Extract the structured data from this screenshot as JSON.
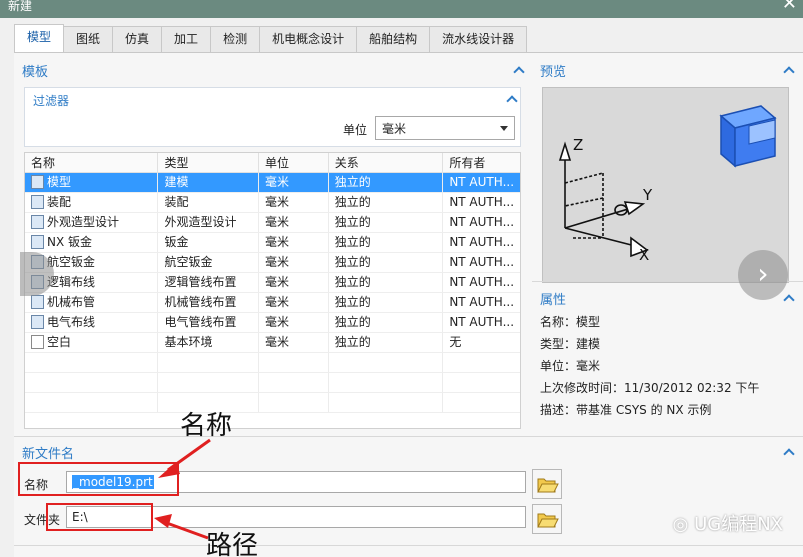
{
  "window": {
    "title": "新建"
  },
  "tabs": [
    "模型",
    "图纸",
    "仿真",
    "加工",
    "检测",
    "机电概念设计",
    "船舶结构",
    "流水线设计器"
  ],
  "template_section": {
    "title": "模板"
  },
  "filter": {
    "title": "过滤器",
    "unit_label": "单位",
    "unit_value": "毫米"
  },
  "table": {
    "headers": [
      "名称",
      "类型",
      "单位",
      "关系",
      "所有者"
    ],
    "rows": [
      [
        "模型",
        "建模",
        "毫米",
        "独立的",
        "NT AUTH..."
      ],
      [
        "装配",
        "装配",
        "毫米",
        "独立的",
        "NT AUTH..."
      ],
      [
        "外观造型设计",
        "外观造型设计",
        "毫米",
        "独立的",
        "NT AUTH..."
      ],
      [
        "NX 钣金",
        "钣金",
        "毫米",
        "独立的",
        "NT AUTH..."
      ],
      [
        "航空钣金",
        "航空钣金",
        "毫米",
        "独立的",
        "NT AUTH..."
      ],
      [
        "逻辑布线",
        "逻辑管线布置",
        "毫米",
        "独立的",
        "NT AUTH..."
      ],
      [
        "机械布管",
        "机械管线布置",
        "毫米",
        "独立的",
        "NT AUTH..."
      ],
      [
        "电气布线",
        "电气管线布置",
        "毫米",
        "独立的",
        "NT AUTH..."
      ],
      [
        "空白",
        "基本环境",
        "毫米",
        "独立的",
        "无"
      ]
    ],
    "selected_index": 0
  },
  "preview": {
    "title": "预览",
    "axis_x": "X",
    "axis_y": "Y",
    "axis_z": "Z"
  },
  "properties": {
    "title": "属性",
    "name_label": "名称：",
    "name_value": "模型",
    "type_label": "类型：",
    "type_value": "建模",
    "unit_label": "单位：",
    "unit_value": "毫米",
    "modified_label": "上次修改时间：",
    "modified_value": "11/30/2012 02:32 下午",
    "desc_label": "描述：",
    "desc_value": "带基准 CSYS 的 NX 示例"
  },
  "new_file": {
    "title": "新文件名",
    "name_label": "名称",
    "name_value": "_model19.prt",
    "folder_label": "文件夹",
    "folder_value": "E:\\"
  },
  "annotations": {
    "name": "名称",
    "path": "路径"
  },
  "watermark": "UG编程NX",
  "next_arrow": "›",
  "colors": {
    "accent": "#2f7cc6",
    "selection": "#3399ff",
    "title_bar": "#6b8a80",
    "annotation": "#e02020"
  }
}
